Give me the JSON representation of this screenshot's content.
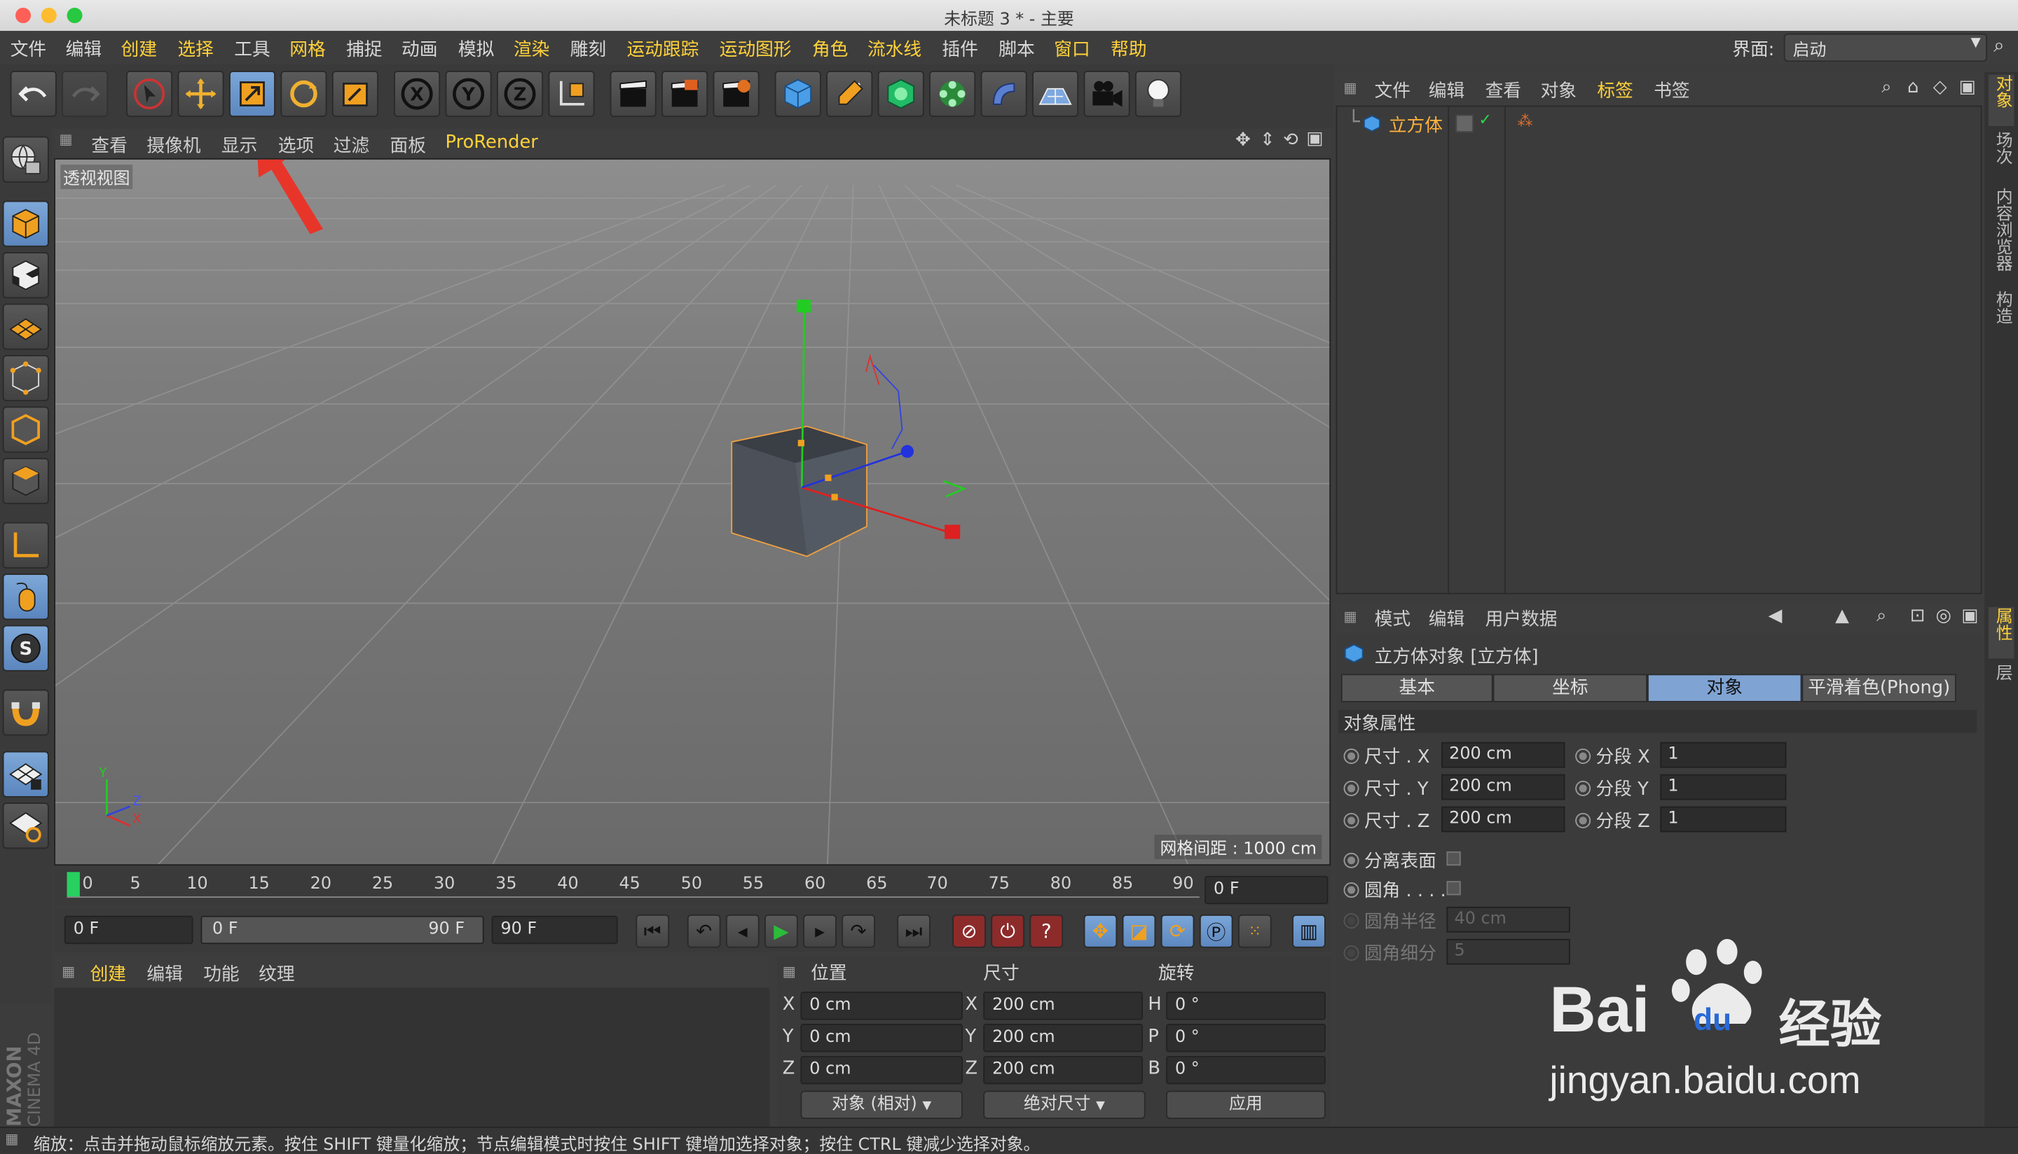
{
  "window": {
    "title": "未标题 3 * - 主要"
  },
  "menu": {
    "items": [
      "文件",
      "编辑",
      "创建",
      "选择",
      "工具",
      "网格",
      "捕捉",
      "动画",
      "模拟",
      "渲染",
      "雕刻",
      "运动跟踪",
      "运动图形",
      "角色",
      "流水线",
      "插件",
      "脚本",
      "窗口",
      "帮助"
    ],
    "interface_label": "界面:",
    "interface_value": "启动"
  },
  "viewport": {
    "menu": [
      "查看",
      "摄像机",
      "显示",
      "选项",
      "过滤",
      "面板",
      "ProRender"
    ],
    "label": "透视视图",
    "grid_spacing": "网格间距 : 1000 cm"
  },
  "timeline": {
    "ticks": [
      "0",
      "5",
      "10",
      "15",
      "20",
      "25",
      "30",
      "35",
      "40",
      "45",
      "50",
      "55",
      "60",
      "65",
      "70",
      "75",
      "80",
      "85",
      "90"
    ],
    "current_frame": "0 F",
    "start_frame": "0 F",
    "range_start": "0 F",
    "range_end": "90 F",
    "end_frame": "90 F"
  },
  "material_manager": {
    "menu": [
      "创建",
      "编辑",
      "功能",
      "纹理"
    ]
  },
  "coordinates": {
    "headers": [
      "位置",
      "尺寸",
      "旋转"
    ],
    "position": [
      {
        "axis": "X",
        "value": "0 cm"
      },
      {
        "axis": "Y",
        "value": "0 cm"
      },
      {
        "axis": "Z",
        "value": "0 cm"
      }
    ],
    "size": [
      {
        "axis": "X",
        "value": "200 cm"
      },
      {
        "axis": "Y",
        "value": "200 cm"
      },
      {
        "axis": "Z",
        "value": "200 cm"
      }
    ],
    "rotation": [
      {
        "axis": "H",
        "value": "0 °"
      },
      {
        "axis": "P",
        "value": "0 °"
      },
      {
        "axis": "B",
        "value": "0 °"
      }
    ],
    "mode": "对象 (相对)",
    "size_mode": "绝对尺寸",
    "apply": "应用"
  },
  "object_manager": {
    "menu": [
      "文件",
      "编辑",
      "查看",
      "对象",
      "标签",
      "书签"
    ],
    "object_name": "立方体"
  },
  "side_tabs": [
    "对象",
    "场次",
    "内容浏览器",
    "构造"
  ],
  "attributes": {
    "menu": [
      "模式",
      "编辑",
      "用户数据"
    ],
    "title": "立方体对象 [立方体]",
    "tabs": [
      "基本",
      "坐标",
      "对象",
      "平滑着色(Phong)"
    ],
    "section": "对象属性",
    "size_x_label": "尺寸 . X",
    "size_x": "200 cm",
    "size_y_label": "尺寸 . Y",
    "size_y": "200 cm",
    "size_z_label": "尺寸 . Z",
    "size_z": "200 cm",
    "seg_x_label": "分段 X",
    "seg_x": "1",
    "seg_y_label": "分段 Y",
    "seg_y": "1",
    "seg_z_label": "分段 Z",
    "seg_z": "1",
    "separate_surfaces": "分离表面",
    "fillet": "圆角 . . . .",
    "fillet_radius_label": "圆角半径",
    "fillet_radius": "40 cm",
    "fillet_subdiv_label": "圆角细分",
    "fillet_subdiv": "5"
  },
  "attr_side_tabs": [
    "属性",
    "层"
  ],
  "status": "缩放：点击并拖动鼠标缩放元素。按住 SHIFT 键量化缩放；节点编辑模式时按住 SHIFT 键增加选择对象；按住 CTRL 键减少选择对象。",
  "brand": {
    "maxon": "MAXON",
    "cinema": "CINEMA 4D"
  },
  "watermark": {
    "site": "jingyan.baidu.com",
    "brand": "Bai",
    "du": "du",
    "jy": "经验"
  },
  "colors": {
    "accent": "#ffd23a",
    "active_blue": "#6f98cf",
    "axis_x": "#e02020",
    "axis_y": "#22cc22",
    "axis_z": "#2233dd",
    "selection": "#f0a040"
  }
}
